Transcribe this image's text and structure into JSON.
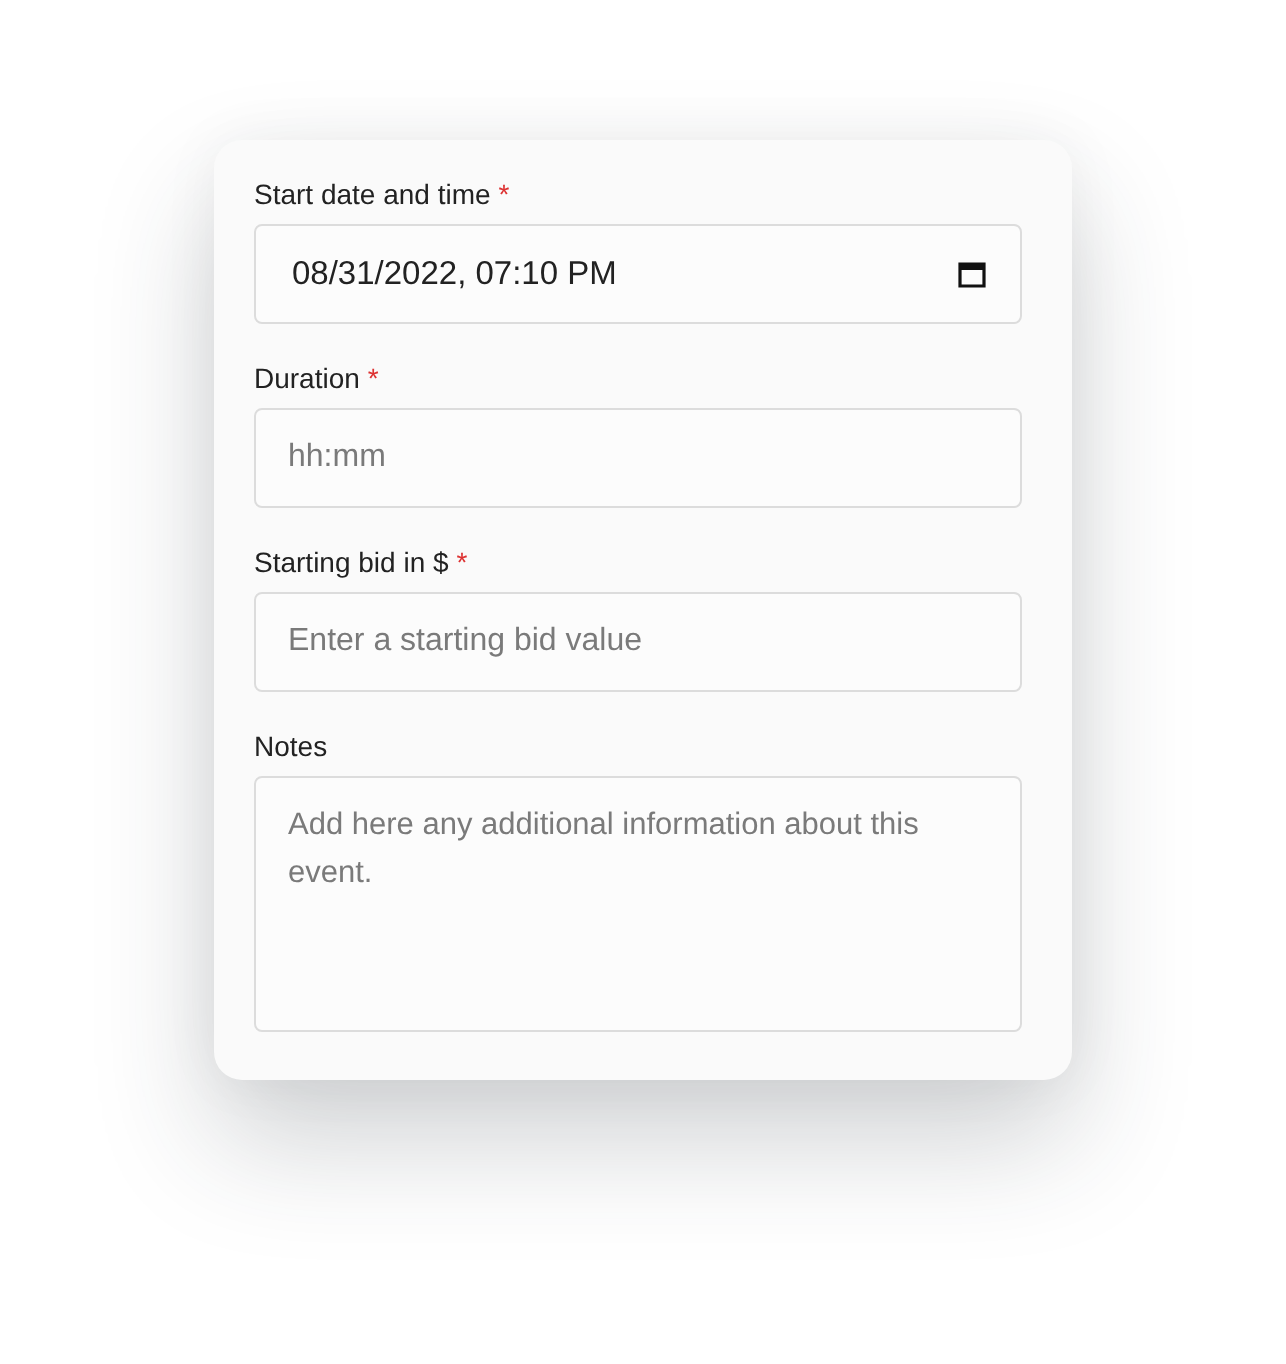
{
  "fields": [
    {
      "kind": "datetime",
      "label": "Start date and time",
      "required_mark": "*",
      "value": "08/31/2022, 07:10 PM"
    },
    {
      "kind": "text",
      "label": "Duration",
      "required_mark": "*",
      "placeholder": "hh:mm"
    },
    {
      "kind": "text",
      "label": "Starting bid in $",
      "required_mark": "*",
      "placeholder": "Enter a starting bid value"
    },
    {
      "kind": "textarea",
      "label": "Notes",
      "placeholder": "Add here any additional information about this event."
    }
  ]
}
